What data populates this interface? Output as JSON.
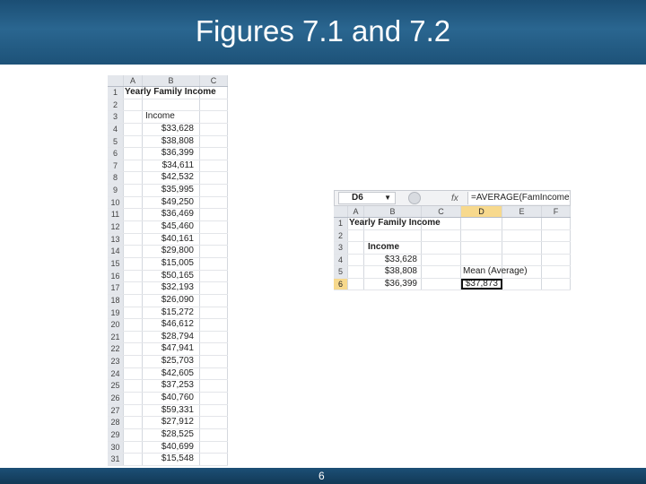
{
  "slide": {
    "title": "Figures 7.1 and 7.2",
    "page_number": "6"
  },
  "colors": {
    "header": "#1b4e74",
    "column_highlight": "#f7d98d"
  },
  "sheet1": {
    "columns": [
      "A",
      "B",
      "C"
    ],
    "title_cell": "Yearly Family Income",
    "header_cell": "Income",
    "rows": [
      {
        "rn": "1",
        "a": "",
        "b": ""
      },
      {
        "rn": "2",
        "a": "",
        "b": ""
      },
      {
        "rn": "3",
        "a": "",
        "b": "Income"
      },
      {
        "rn": "4",
        "a": "",
        "b": "$33,628"
      },
      {
        "rn": "5",
        "a": "",
        "b": "$38,808"
      },
      {
        "rn": "6",
        "a": "",
        "b": "$36,399"
      },
      {
        "rn": "7",
        "a": "",
        "b": "$34,611"
      },
      {
        "rn": "8",
        "a": "",
        "b": "$42,532"
      },
      {
        "rn": "9",
        "a": "",
        "b": "$35,995"
      },
      {
        "rn": "10",
        "a": "",
        "b": "$49,250"
      },
      {
        "rn": "11",
        "a": "",
        "b": "$36,469"
      },
      {
        "rn": "12",
        "a": "",
        "b": "$45,460"
      },
      {
        "rn": "13",
        "a": "",
        "b": "$40,161"
      },
      {
        "rn": "14",
        "a": "",
        "b": "$29,800"
      },
      {
        "rn": "15",
        "a": "",
        "b": "$15,005"
      },
      {
        "rn": "16",
        "a": "",
        "b": "$50,165"
      },
      {
        "rn": "17",
        "a": "",
        "b": "$32,193"
      },
      {
        "rn": "18",
        "a": "",
        "b": "$26,090"
      },
      {
        "rn": "19",
        "a": "",
        "b": "$15,272"
      },
      {
        "rn": "20",
        "a": "",
        "b": "$46,612"
      },
      {
        "rn": "21",
        "a": "",
        "b": "$28,794"
      },
      {
        "rn": "22",
        "a": "",
        "b": "$47,941"
      },
      {
        "rn": "23",
        "a": "",
        "b": "$25,703"
      },
      {
        "rn": "24",
        "a": "",
        "b": "$42,605"
      },
      {
        "rn": "25",
        "a": "",
        "b": "$37,253"
      },
      {
        "rn": "26",
        "a": "",
        "b": "$40,760"
      },
      {
        "rn": "27",
        "a": "",
        "b": "$59,331"
      },
      {
        "rn": "28",
        "a": "",
        "b": "$27,912"
      },
      {
        "rn": "29",
        "a": "",
        "b": "$28,525"
      },
      {
        "rn": "30",
        "a": "",
        "b": "$40,699"
      },
      {
        "rn": "31",
        "a": "",
        "b": "$15,548"
      }
    ]
  },
  "sheet2": {
    "name_box": "D6",
    "fx_label": "fx",
    "formula": "=AVERAGE(FamIncome)",
    "columns": [
      "A",
      "B",
      "C",
      "D",
      "E",
      "F"
    ],
    "title_cell": "Yearly Family Income",
    "header_cell": "Income",
    "mean_label": "Mean (Average)",
    "mean_value": "$37,873",
    "rows": [
      {
        "rn": "1",
        "b": ""
      },
      {
        "rn": "2",
        "b": ""
      },
      {
        "rn": "3",
        "b": "Income"
      },
      {
        "rn": "4",
        "b": "$33,628"
      },
      {
        "rn": "5",
        "b": "$38,808"
      },
      {
        "rn": "6",
        "b": "$36,399"
      }
    ]
  }
}
